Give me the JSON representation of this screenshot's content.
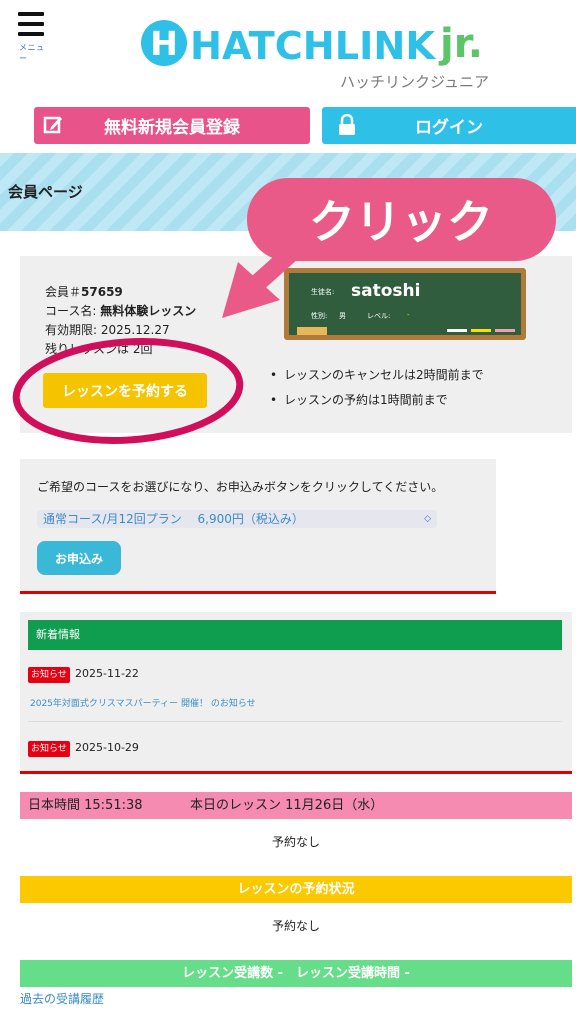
{
  "header": {
    "menu_label": "メニュー",
    "logo_text": "HATCHLINK",
    "logo_suffix": "jr.",
    "logo_kana": "ハッチリンクジュニア"
  },
  "nav": {
    "register_label": "無料新規会員登録",
    "login_label": "ログイン"
  },
  "page_title": "会員ページ",
  "member": {
    "id_label": "会員＃",
    "id_value": "57659",
    "course_label": "コース名:",
    "course_value": "無料体験レッスン",
    "expiry_label": "有効期限:",
    "expiry_value": "2025.12.27",
    "remaining_label": "残りレッスンは",
    "remaining_value": "2回",
    "reserve_button": "レッスンを予約する",
    "board": {
      "student_label": "生徒名:",
      "student_name": "satoshi",
      "gender_label": "性別:",
      "gender_value": "男",
      "level_label": "レベル:",
      "level_value": "-"
    },
    "notes": [
      "レッスンのキャンセルは2時間前まで",
      "レッスンの予約は1時間前まで"
    ]
  },
  "course": {
    "description": "ご希望のコースをお選びになり、お申込みボタンをクリックしてください。",
    "selected": "通常コース/月12回プラン　 6,900円（税込み）",
    "apply_button": "お申込み"
  },
  "news": {
    "heading": "新着情報",
    "items": [
      {
        "badge": "お知らせ",
        "date": "2025-11-22",
        "title": "2025年対面式クリスマスパーティー 開催！ のお知らせ"
      },
      {
        "badge": "お知らせ",
        "date": "2025-10-29",
        "title": ""
      }
    ]
  },
  "schedule": {
    "time_label": "日本時間 15:51:38",
    "today_label": "本日のレッスン 11月26日（水）",
    "today_none": "予約なし",
    "status_heading": "レッスンの予約状況",
    "status_none": "予約なし",
    "count_heading": "レッスン受講数 -　レッスン受講時間 -",
    "history_link": "過去の受講履歴"
  },
  "annotation": {
    "callout_text": "クリック"
  },
  "colors": {
    "pink": "#e8548a",
    "cyan": "#2fc0e8",
    "yellow": "#f6c300",
    "green": "#0f9d4f",
    "red": "#e00000"
  }
}
